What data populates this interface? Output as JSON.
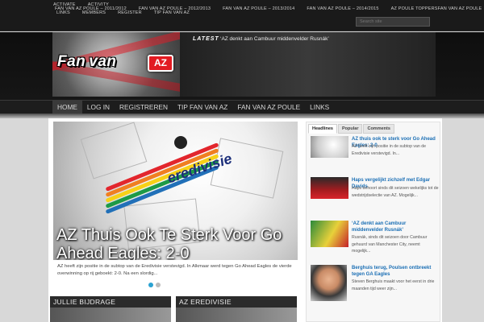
{
  "topbar": {
    "row1": [
      "Activate",
      "Activity"
    ],
    "row2": [
      "Fan van AZ Poule – 2011/2012",
      "Fan van AZ Poule – 2012/2013",
      "Fan van AZ Poule – 2013/2014",
      "Fan van AZ Poule – 2014/2015",
      "AZ Poule Toppers",
      "Fan van AZ Poule"
    ],
    "row3": [
      "Links",
      "Members",
      "Register",
      "Tip Fan van AZ"
    ],
    "search_placeholder": "Search site"
  },
  "logo": {
    "word1": "Fan",
    "word2": "van",
    "badge": "AZ"
  },
  "latest": {
    "label": "LATEST",
    "text": "‘AZ denkt aan Cambuur middenvelder Rusnák’"
  },
  "nav": {
    "items": [
      "Home",
      "Log in",
      "Registreren",
      "Tip Fan van AZ",
      "Fan van AZ Poule",
      "Links"
    ]
  },
  "slider": {
    "logo_text": "eredivisie",
    "title": "AZ Thuis Ook Te Sterk Voor Go Ahead Eagles: 2-0",
    "text": "AZ heeft zijn positie in de subtop van de Eredivisie verstevigd. In Alkmaar werd tegen Go Ahead Eagles de vierde overwinning op rij geboekt: 2-0. Na een slordig..."
  },
  "sections": {
    "left": "Jullie bijdrage",
    "right": "AZ Eredivisie"
  },
  "tabs": {
    "labels": [
      "Headlines",
      "Popular",
      "Comments"
    ]
  },
  "posts": [
    {
      "title": "AZ thuis ook te sterk voor Go Ahead Eagles: 2-0",
      "excerpt": "AZ heeft zijn positie in de subtop van de Eredivisie verstevigd. In..."
    },
    {
      "title": "Haps vergelijkt zichzelf met Edgar Davids",
      "excerpt": "Haps behoort sinds dit seizoen wekelijks tot de wedstrijdselectie van AZ. Mogelijk..."
    },
    {
      "title": "‘AZ denkt aan Cambuur middenvelder Rusnák’",
      "excerpt": "Rusnák, sinds dit seizoen door Cambuur gehuurd van Manchester City, neemt mogelijk..."
    },
    {
      "title": "Berghuis terug, Poulsen ontbreekt tegen GA Eagles",
      "excerpt": "Steven Berghuis maakt voor het eerst in drie maanden tijd weer zijn..."
    }
  ]
}
